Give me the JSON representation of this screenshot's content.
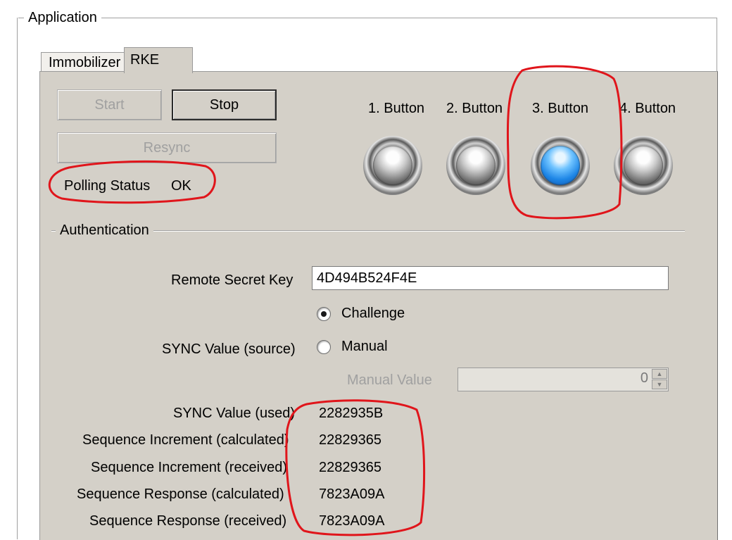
{
  "window": {
    "group_label": "Application"
  },
  "tabs": [
    {
      "label": "Immobilizer",
      "active": false
    },
    {
      "label": "RKE",
      "active": true
    }
  ],
  "controls": {
    "start_label": "Start",
    "start_enabled": false,
    "stop_label": "Stop",
    "stop_enabled": true,
    "resync_label": "Resync",
    "resync_enabled": false,
    "polling_status_label": "Polling Status",
    "polling_status_value": "OK"
  },
  "buttons": [
    {
      "label": "1. Button",
      "lit": false
    },
    {
      "label": "2. Button",
      "lit": false
    },
    {
      "label": "3. Button",
      "lit": true
    },
    {
      "label": "4. Button",
      "lit": false
    }
  ],
  "authentication": {
    "group_label": "Authentication",
    "remote_secret_key_label": "Remote Secret Key",
    "remote_secret_key_value": "4D494B524F4E",
    "sync_source_label": "SYNC Value (source)",
    "sync_options": [
      {
        "label": "Challenge",
        "checked": true
      },
      {
        "label": "Manual",
        "checked": false
      }
    ],
    "manual_value_label": "Manual Value",
    "manual_value": "0"
  },
  "results": [
    {
      "label": "SYNC Value (used)",
      "value": "2282935B"
    },
    {
      "label": "Sequence Increment (calculated)",
      "value": "22829365"
    },
    {
      "label": "Sequence Increment (received)",
      "value": "22829365"
    },
    {
      "label": "Sequence Response (calculated)",
      "value": "7823A09A"
    },
    {
      "label": "Sequence Response (received)",
      "value": "7823A09A"
    }
  ],
  "colors": {
    "dialog_bg": "#d4d0c8",
    "led_on": "#1e86e6",
    "annotation": "#e0151b"
  }
}
